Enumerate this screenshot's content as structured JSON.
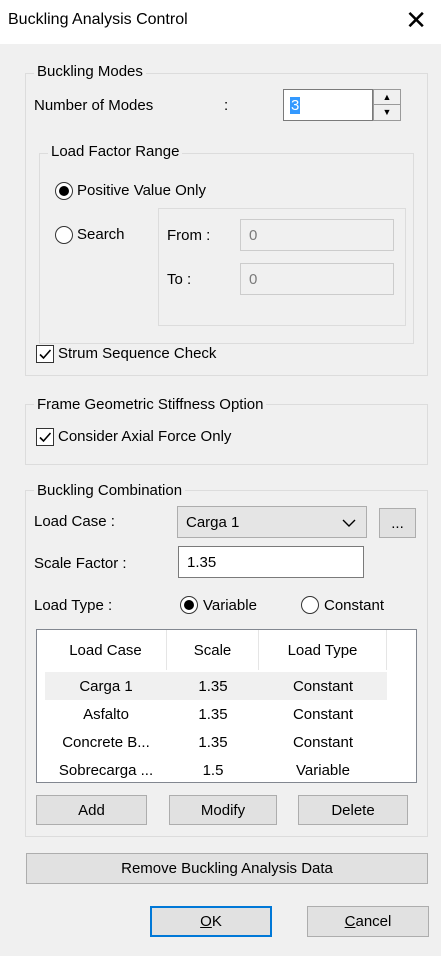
{
  "window": {
    "title": "Buckling Analysis Control",
    "close_icon": "close-icon"
  },
  "buckling_modes": {
    "legend": "Buckling Modes",
    "number_of_modes_label": "Number of Modes",
    "colon": ":",
    "number_of_modes_value": "3",
    "load_factor_range": {
      "legend": "Load Factor Range",
      "positive_label": "Positive Value Only",
      "search_label": "Search",
      "selected": "positive",
      "from_label": "From :",
      "from_value": "0",
      "to_label": "To :",
      "to_value": "0"
    },
    "strum_label": "Strum Sequence Check",
    "strum_checked": true
  },
  "frame_geometric": {
    "legend": "Frame Geometric Stiffness Option",
    "axial_label": "Consider Axial Force Only",
    "axial_checked": true
  },
  "buckling_combination": {
    "legend": "Buckling Combination",
    "load_case_label": "Load Case :",
    "load_case_value": "Carga 1",
    "ellipsis_label": "...",
    "scale_factor_label": "Scale Factor :",
    "scale_factor_value": "1.35",
    "load_type_label": "Load Type :",
    "variable_label": "Variable",
    "constant_label": "Constant",
    "load_type_selected": "variable",
    "table": {
      "headers": [
        "Load Case",
        "Scale",
        "Load Type"
      ],
      "rows": [
        {
          "case": "Carga 1",
          "scale": "1.35",
          "type": "Constant",
          "selected": true
        },
        {
          "case": "Asfalto",
          "scale": "1.35",
          "type": "Constant"
        },
        {
          "case": "Concrete B...",
          "scale": "1.35",
          "type": "Constant"
        },
        {
          "case": "Sobrecarga ...",
          "scale": "1.5",
          "type": "Variable"
        }
      ]
    },
    "add_label": "Add",
    "modify_label": "Modify",
    "delete_label": "Delete"
  },
  "remove_label": "Remove Buckling Analysis Data",
  "ok_label": "OK",
  "cancel_label": "Cancel",
  "colors": {
    "window_bg": "#f0f0f0",
    "accent": "#0078d7",
    "selection": "#3399ff"
  }
}
